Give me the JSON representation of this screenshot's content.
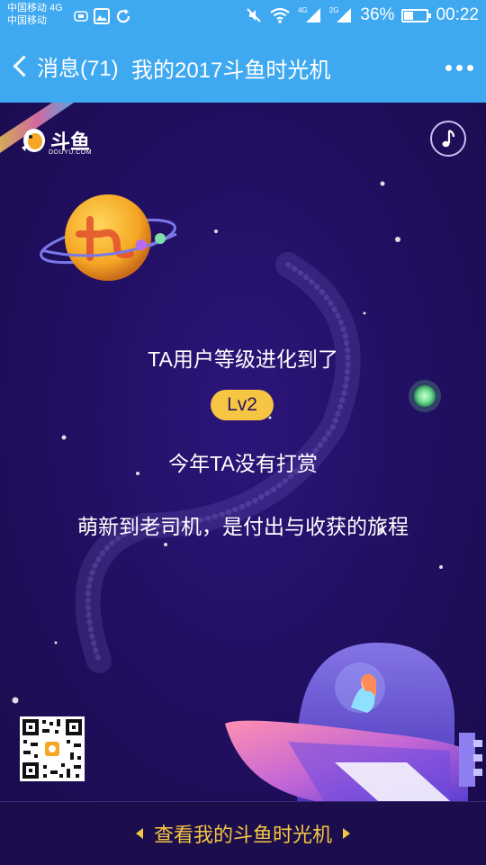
{
  "status_bar": {
    "carrier_line1": "中国移动 4G",
    "carrier_line2": "中国移动",
    "net_1": "4G",
    "net_2": "2G",
    "battery_text": "36%",
    "battery_level": 0.36,
    "time": "00:22"
  },
  "nav": {
    "back_label": "消息(71)",
    "title": "我的2017斗鱼时光机"
  },
  "brand": {
    "logo_text": "斗鱼",
    "logo_sub": "DOUYU.COM"
  },
  "content": {
    "line1": "TA用户等级进化到了",
    "level_badge": "Lv2",
    "line3": "今年TA没有打赏",
    "line4": "萌新到老司机，是付出与收获的旅程"
  },
  "bottom": {
    "button_label": "查看我的斗鱼时光机"
  },
  "colors": {
    "header_blue": "#3ea8f0",
    "bg_purple": "#221064",
    "accent_yellow": "#f6c543"
  }
}
